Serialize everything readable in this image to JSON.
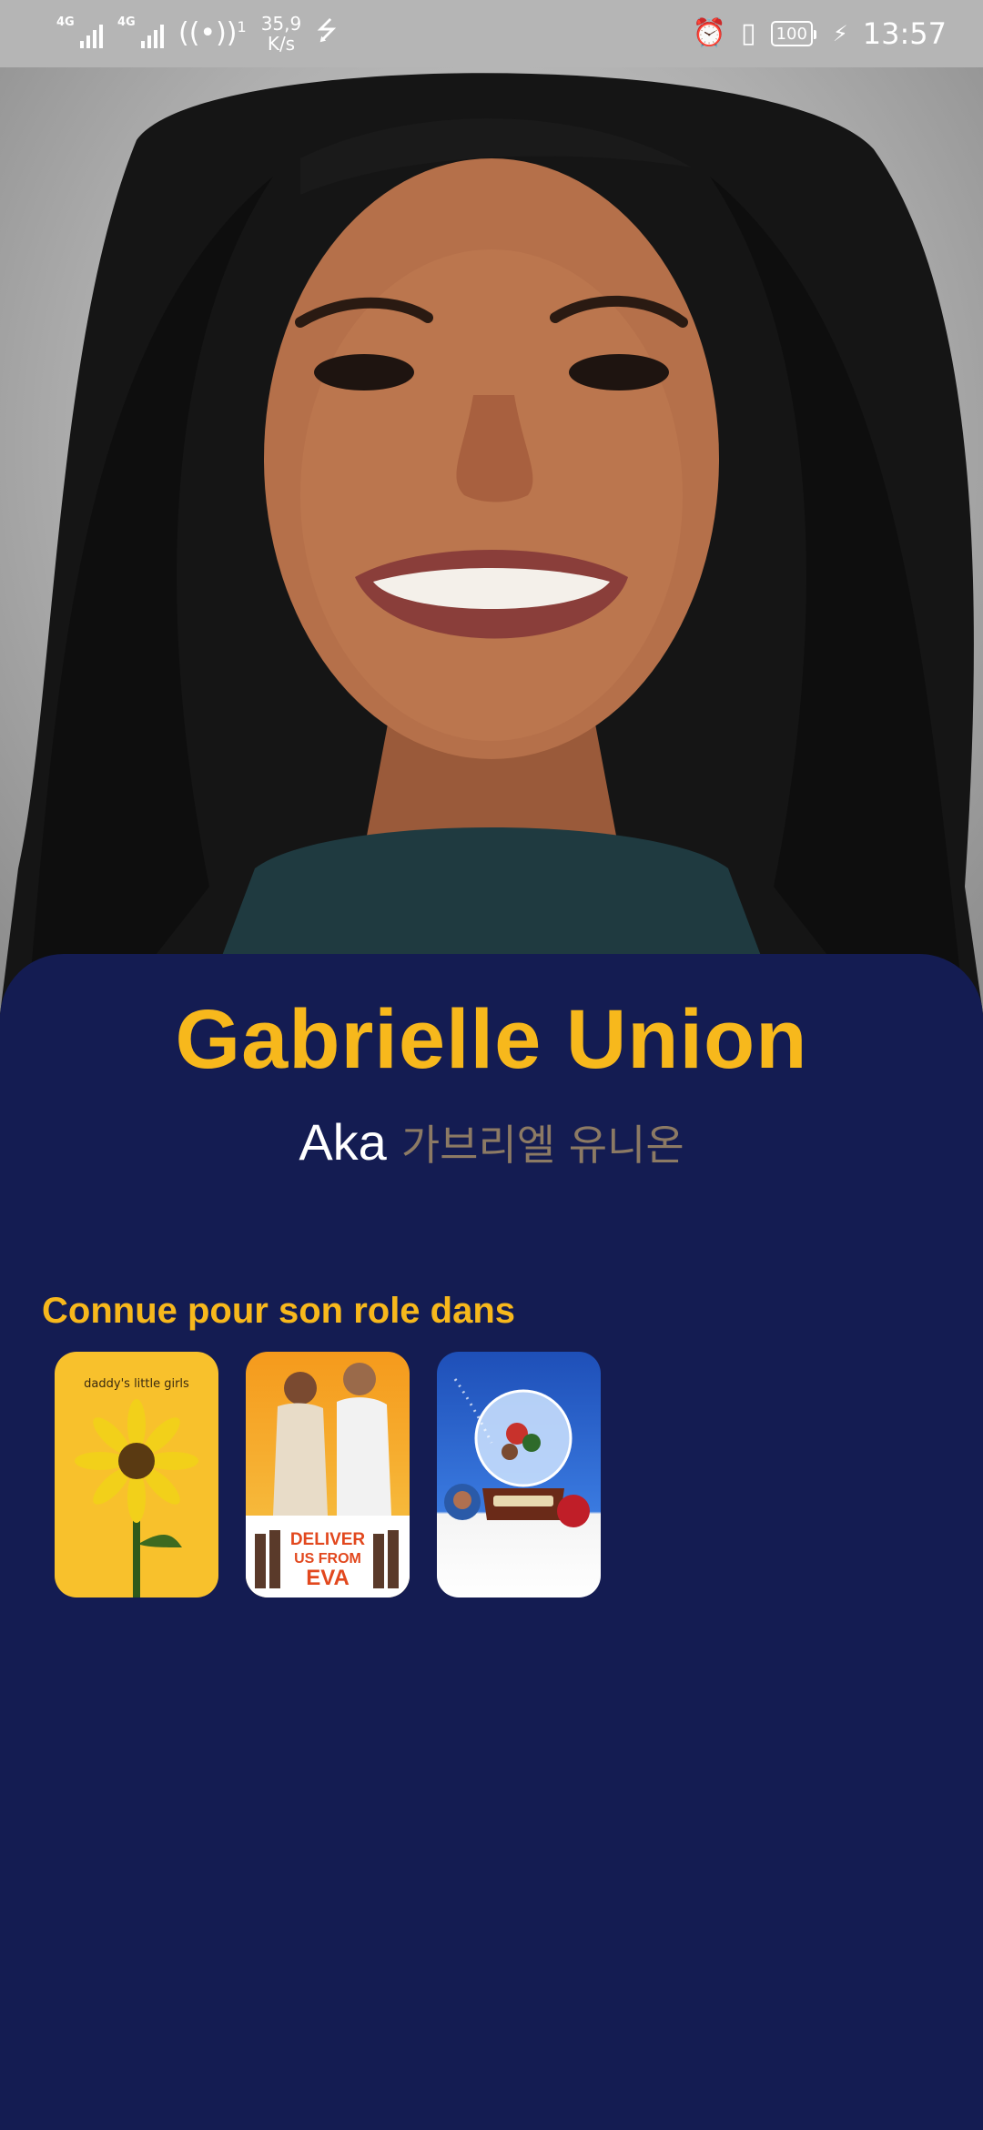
{
  "status_bar": {
    "network_1": "4G",
    "network_2": "4G",
    "hotspot_count": "1",
    "speed_value": "35,9",
    "speed_unit": "K/s",
    "battery": "100",
    "time": "13:57"
  },
  "person": {
    "name": "Gabrielle Union",
    "aka_label": "Aka",
    "aka_name": "가브리엘 유니온"
  },
  "known_for": {
    "title": "Connue pour son role dans",
    "posters": [
      {
        "caption": "daddy's little girls"
      },
      {
        "caption": "DELIVER US FROM EVA"
      },
      {
        "caption": ""
      }
    ]
  },
  "colors": {
    "accent": "#f7b81c",
    "background": "#141c52",
    "status_bar": "#b5b5b5"
  }
}
